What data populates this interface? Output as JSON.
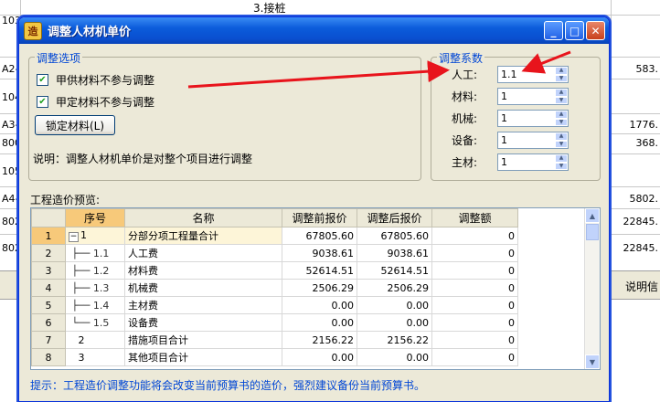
{
  "background": {
    "row_codes": [
      "103(",
      "A2-",
      "104(",
      "A3-",
      "800",
      "105(",
      "A4-",
      "802",
      "802"
    ],
    "right_values": [
      "583.",
      "1776.",
      "368.",
      "5802.",
      "22845.",
      "22845."
    ],
    "top_text": "3.接桩",
    "band_text": "说明信"
  },
  "dialog": {
    "title": "调整人材机单价",
    "minimize_label": "_",
    "maximize_label": "□",
    "close_label": "✕",
    "options_title": "调整选项",
    "checkbox_1": "甲供材料不参与调整",
    "checkbox_2": "甲定材料不参与调整",
    "lock_button": "锁定材料(L)",
    "note": "说明：调整人材机单价是对整个项目进行调整",
    "coef_title": "调整系数",
    "coefficients": [
      {
        "label": "人工:",
        "value": "1.1"
      },
      {
        "label": "材料:",
        "value": "1"
      },
      {
        "label": "机械:",
        "value": "1"
      },
      {
        "label": "设备:",
        "value": "1"
      },
      {
        "label": "主材:",
        "value": "1"
      }
    ],
    "preview_label": "工程造价预览:",
    "columns": [
      "序号",
      "名称",
      "调整前报价",
      "调整后报价",
      "调整额"
    ],
    "rows": [
      {
        "rn": "1",
        "seq": "1",
        "name": "分部分项工程量合计",
        "before": "67805.60",
        "after": "67805.60",
        "delta": "0"
      },
      {
        "rn": "2",
        "seq": "1.1",
        "name": "人工费",
        "before": "9038.61",
        "after": "9038.61",
        "delta": "0"
      },
      {
        "rn": "3",
        "seq": "1.2",
        "name": "材料费",
        "before": "52614.51",
        "after": "52614.51",
        "delta": "0"
      },
      {
        "rn": "4",
        "seq": "1.3",
        "name": "机械费",
        "before": "2506.29",
        "after": "2506.29",
        "delta": "0"
      },
      {
        "rn": "5",
        "seq": "1.4",
        "name": "主材费",
        "before": "0.00",
        "after": "0.00",
        "delta": "0"
      },
      {
        "rn": "6",
        "seq": "1.5",
        "name": "设备费",
        "before": "0.00",
        "after": "0.00",
        "delta": "0"
      },
      {
        "rn": "7",
        "seq": "2",
        "name": "措施项目合计",
        "before": "2156.22",
        "after": "2156.22",
        "delta": "0"
      },
      {
        "rn": "8",
        "seq": "3",
        "name": "其他项目合计",
        "before": "0.00",
        "after": "0.00",
        "delta": "0"
      }
    ],
    "hint": "提示：工程造价调整功能将会改变当前预算书的造价，强烈建议备份当前预算书。"
  },
  "annotation_color": "#e8141c"
}
